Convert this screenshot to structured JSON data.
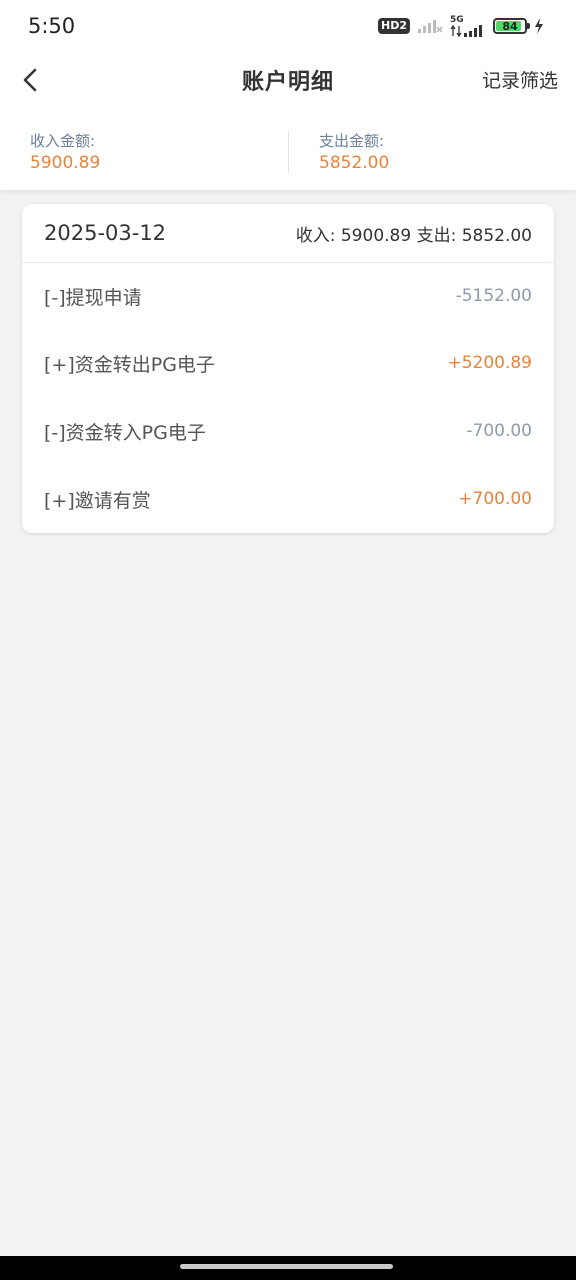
{
  "status_bar": {
    "time": "5:50",
    "hd_label": "HD2",
    "network_label": "5G",
    "battery_level": "84"
  },
  "nav": {
    "title": "账户明细",
    "filter_label": "记录筛选"
  },
  "summary": {
    "income_label": "收入金额:",
    "income_value": "5900.89",
    "expense_label": "支出金额:",
    "expense_value": "5852.00"
  },
  "day_group": {
    "date": "2025-03-12",
    "totals_text": "收入: 5900.89 支出: 5852.00"
  },
  "transactions": [
    {
      "label": "[-]提现申请",
      "amount": "-5152.00",
      "kind": "negative"
    },
    {
      "label": "[+]资金转出PG电子",
      "amount": "+5200.89",
      "kind": "positive"
    },
    {
      "label": "[-]资金转入PG电子",
      "amount": "-700.00",
      "kind": "negative"
    },
    {
      "label": "[+]邀请有赏",
      "amount": "+700.00",
      "kind": "positive"
    }
  ],
  "colors": {
    "accent_orange": "#e8843a",
    "negative_gray": "#8f9aab",
    "label_blue_gray": "#6d7f9a",
    "page_background": "#f2f3f5"
  }
}
